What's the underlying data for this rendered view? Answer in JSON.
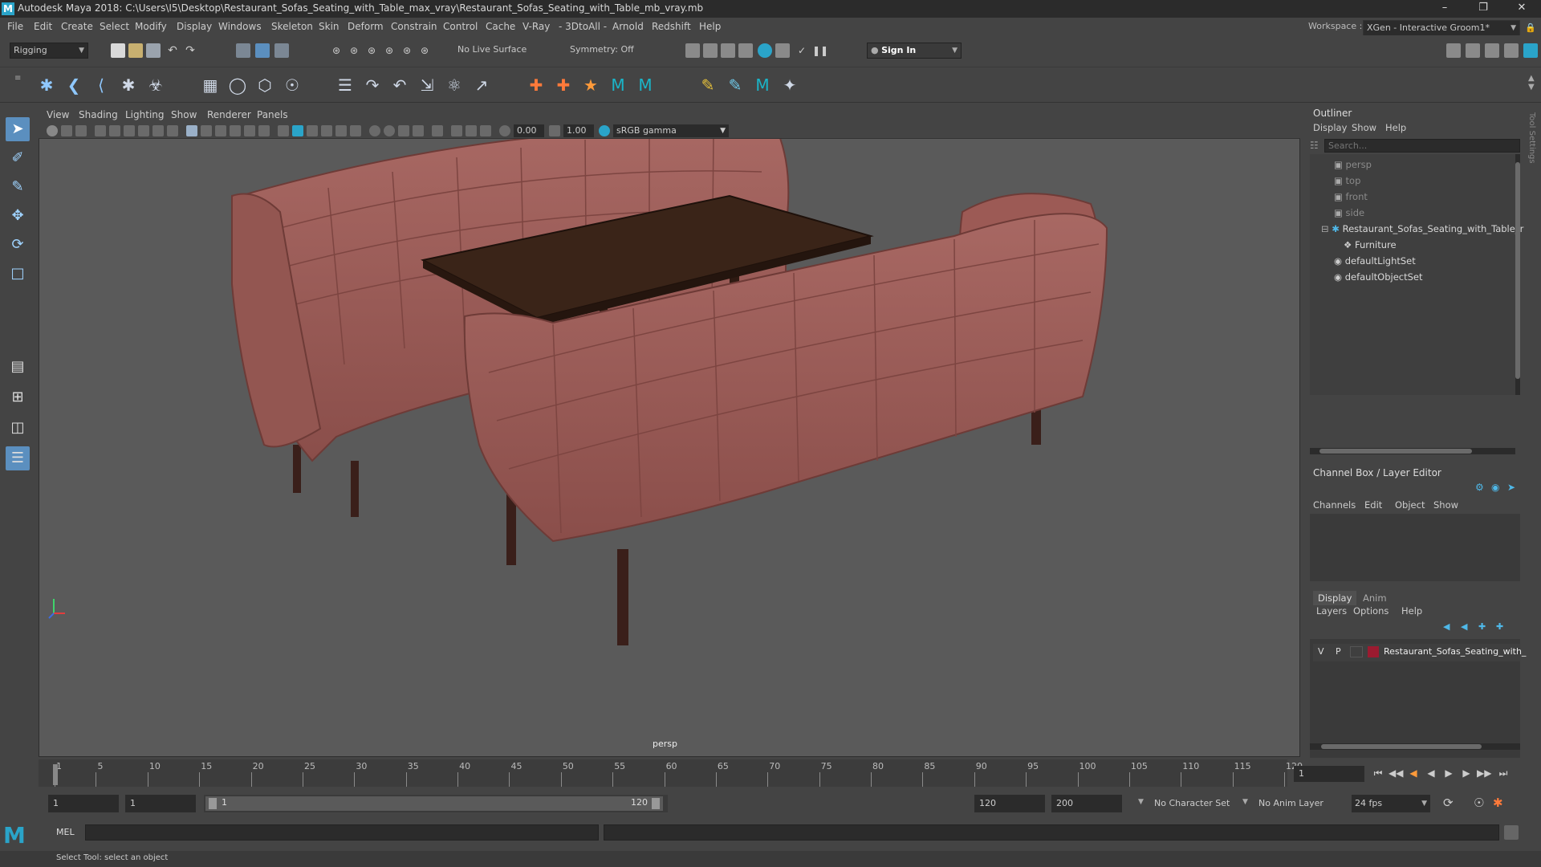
{
  "window": {
    "title": "Autodesk Maya 2018: C:\\Users\\I5\\Desktop\\Restaurant_Sofas_Seating_with_Table_max_vray\\Restaurant_Sofas_Seating_with_Table_mb_vray.mb"
  },
  "menubar": {
    "items": [
      "File",
      "Edit",
      "Create",
      "Select",
      "Modify",
      "Display",
      "Windows",
      "Skeleton",
      "Skin",
      "Deform",
      "Constrain",
      "Control",
      "Cache",
      "V-Ray",
      "- 3DtoAll -",
      "Arnold",
      "Redshift",
      "Help"
    ],
    "workspace_label": "Workspace :",
    "workspace_value": "XGen - Interactive Groom1*"
  },
  "statusline": {
    "menuset": "Rigging",
    "live_surface": "No Live Surface",
    "symmetry": "Symmetry: Off",
    "sign_in": "Sign In"
  },
  "viewport": {
    "menu": [
      "View",
      "Shading",
      "Lighting",
      "Show",
      "Renderer",
      "Panels"
    ],
    "exposure": "0.00",
    "gamma": "1.00",
    "color_space": "sRGB gamma",
    "camera_label": "persp"
  },
  "outliner": {
    "title": "Outliner",
    "menu": [
      "Display",
      "Show",
      "Help"
    ],
    "search_placeholder": "Search...",
    "items": [
      {
        "label": "persp",
        "type": "camera",
        "dim": true
      },
      {
        "label": "top",
        "type": "camera",
        "dim": true
      },
      {
        "label": "front",
        "type": "camera",
        "dim": true
      },
      {
        "label": "side",
        "type": "camera",
        "dim": true
      },
      {
        "label": "Restaurant_Sofas_Seating_with_Table_r",
        "type": "group",
        "dim": false
      },
      {
        "label": "Furniture",
        "type": "transform",
        "dim": false
      },
      {
        "label": "defaultLightSet",
        "type": "set",
        "dim": false
      },
      {
        "label": "defaultObjectSet",
        "type": "set",
        "dim": false
      }
    ]
  },
  "channelbox": {
    "title": "Channel Box / Layer Editor",
    "menu": [
      "Channels",
      "Edit",
      "Object",
      "Show"
    ]
  },
  "layereditor": {
    "tabs": [
      "Display",
      "Anim"
    ],
    "menu": [
      "Layers",
      "Options",
      "Help"
    ],
    "layer": {
      "v": "V",
      "p": "P",
      "name": "Restaurant_Sofas_Seating_with_",
      "color": "#9b1b30"
    }
  },
  "timeslider": {
    "ticks": [
      "1",
      "5",
      "10",
      "15",
      "20",
      "25",
      "30",
      "35",
      "40",
      "45",
      "50",
      "55",
      "60",
      "65",
      "70",
      "75",
      "80",
      "85",
      "90",
      "95",
      "100",
      "105",
      "110",
      "115",
      "120"
    ],
    "current_frame": "1"
  },
  "rangebar": {
    "start": "1",
    "playback_start": "1",
    "range_start": "1",
    "range_end": "120",
    "playback_end": "120",
    "end": "200",
    "character_set": "No Character Set",
    "anim_layer": "No Anim Layer",
    "fps": "24 fps"
  },
  "cmdline": {
    "label": "MEL"
  },
  "helpline": {
    "text": "Select Tool: select an object"
  },
  "colors": {
    "accent": "#2aa4c9",
    "sofa": "#9c5a55",
    "table": "#3a2418",
    "layer_color": "#9b1b30"
  }
}
